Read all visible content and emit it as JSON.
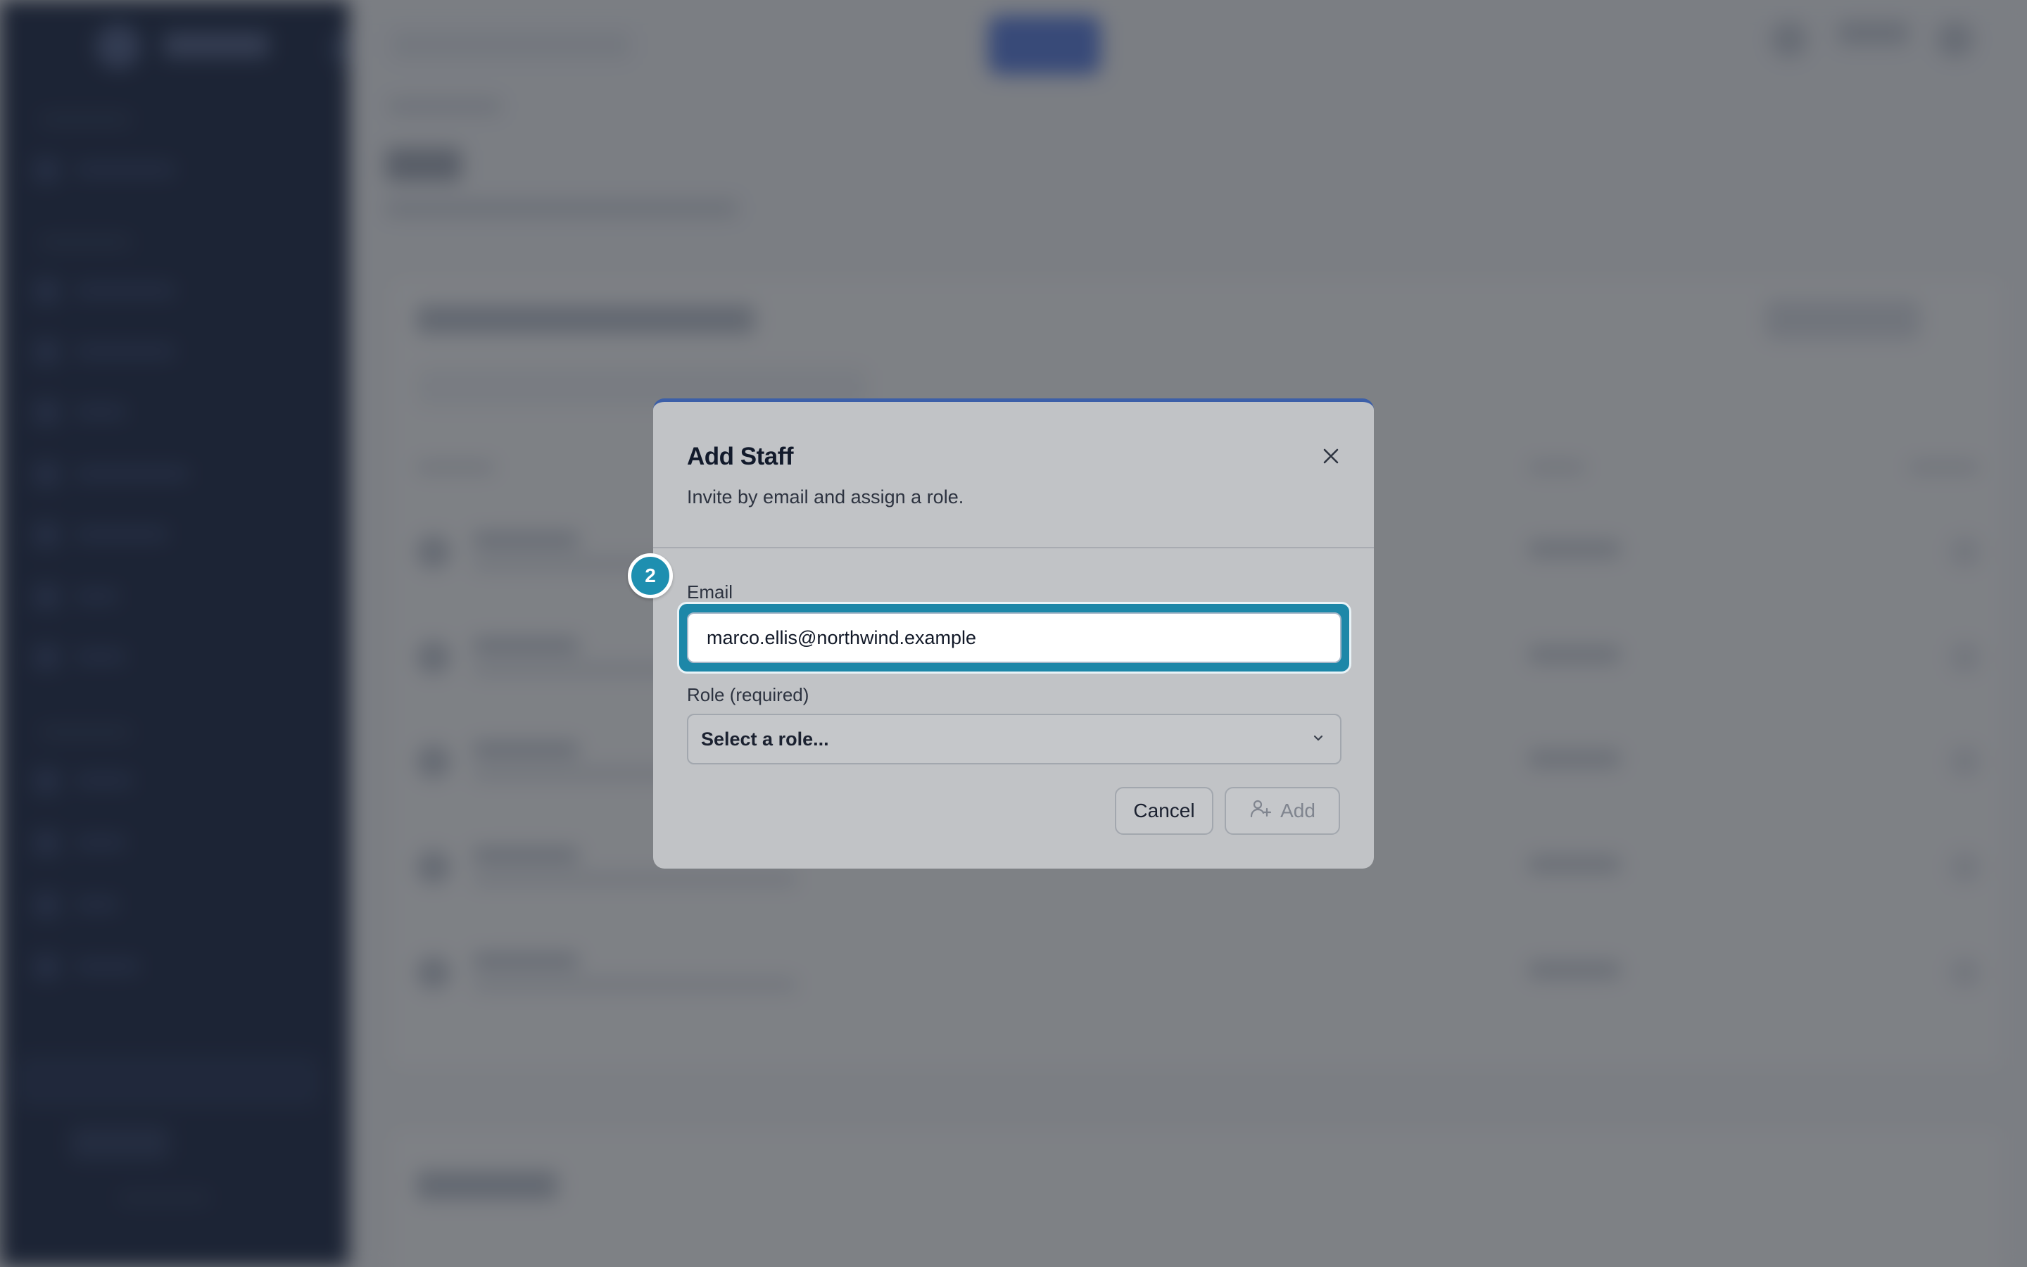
{
  "dialog": {
    "title": "Add Staff",
    "subtitle": "Invite by email and assign a role.",
    "close_icon": "close-icon",
    "step_number": "2",
    "email": {
      "label": "Email",
      "value": "marco.ellis@northwind.example"
    },
    "role": {
      "label": "Role (required)",
      "selected": "Select a role...",
      "icon": "chevron-down-icon"
    },
    "buttons": {
      "cancel": "Cancel",
      "add": "Add",
      "add_icon": "user-plus-icon"
    }
  },
  "colors": {
    "accent": "#1e8fb0",
    "modal_top_border": "#3c5fa8",
    "sidebar": "#1d2a47",
    "title_text": "#121a2b"
  }
}
